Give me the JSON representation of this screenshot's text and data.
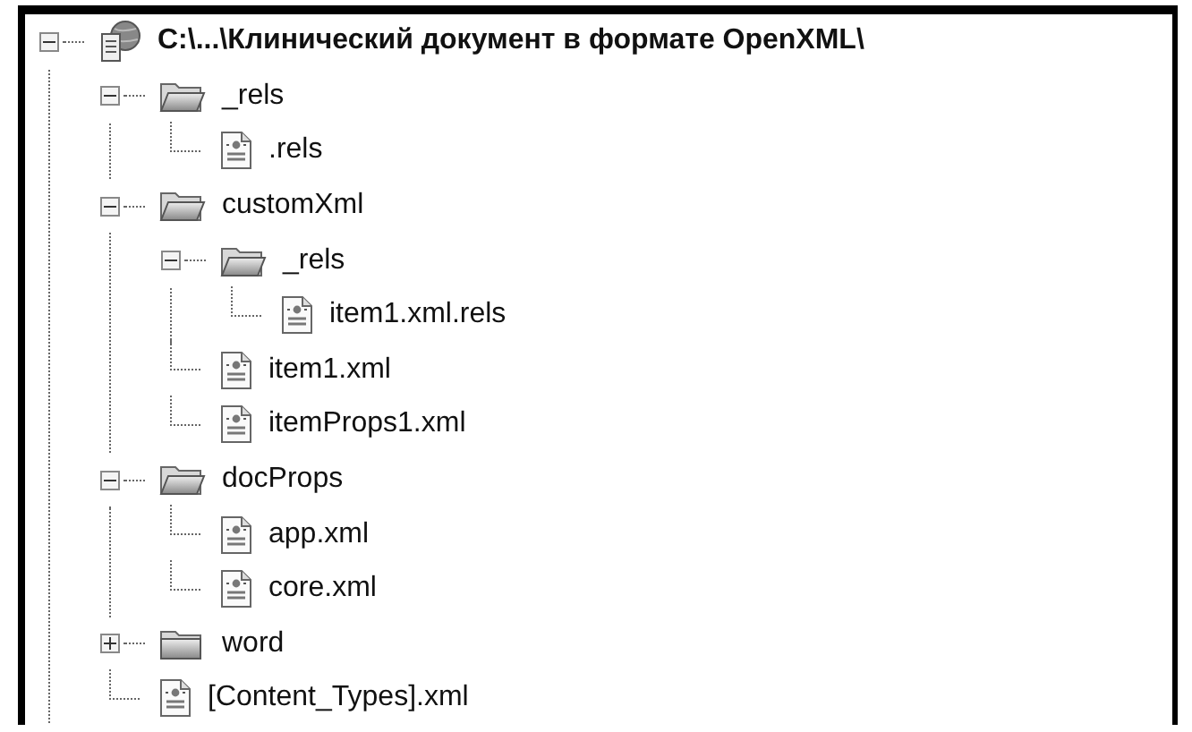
{
  "tree": [
    {
      "kind": "root",
      "label": "C:\\...\\Клинический документ в формате OpenXML\\",
      "expanded": true,
      "children": [
        {
          "kind": "folder",
          "label": "_rels",
          "expanded": true,
          "children": [
            {
              "kind": "file",
              "label": ".rels"
            }
          ]
        },
        {
          "kind": "folder",
          "label": "customXml",
          "expanded": true,
          "children": [
            {
              "kind": "folder",
              "label": "_rels",
              "expanded": true,
              "children": [
                {
                  "kind": "file",
                  "label": "item1.xml.rels"
                }
              ]
            },
            {
              "kind": "file",
              "label": "item1.xml"
            },
            {
              "kind": "file",
              "label": "itemProps1.xml"
            }
          ]
        },
        {
          "kind": "folder",
          "label": "docProps",
          "expanded": true,
          "children": [
            {
              "kind": "file",
              "label": "app.xml"
            },
            {
              "kind": "file",
              "label": "core.xml"
            }
          ]
        },
        {
          "kind": "folder",
          "label": "word",
          "expanded": false
        },
        {
          "kind": "file",
          "label": "[Content_Types].xml"
        }
      ]
    }
  ]
}
